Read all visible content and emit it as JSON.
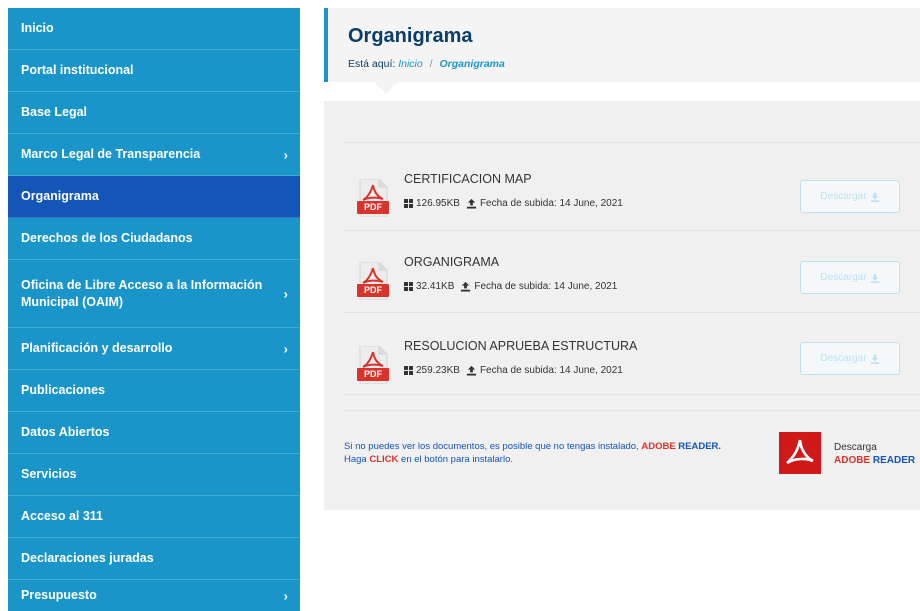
{
  "sidebar": {
    "items": [
      {
        "label": "Inicio",
        "has_submenu": false
      },
      {
        "label": "Portal institucional",
        "has_submenu": false
      },
      {
        "label": "Base Legal",
        "has_submenu": false
      },
      {
        "label": "Marco Legal de Transparencia",
        "has_submenu": true
      },
      {
        "label": "Organigrama",
        "has_submenu": false,
        "active": true
      },
      {
        "label": "Derechos de los Ciudadanos",
        "has_submenu": false
      },
      {
        "label": "Oficina de Libre Acceso a la Información Municipal (OAIM)",
        "has_submenu": true
      },
      {
        "label": "Planificación y desarrollo",
        "has_submenu": true
      },
      {
        "label": "Publicaciones",
        "has_submenu": false
      },
      {
        "label": "Datos Abiertos",
        "has_submenu": false
      },
      {
        "label": "Servicios",
        "has_submenu": false
      },
      {
        "label": "Acceso al 311",
        "has_submenu": false
      },
      {
        "label": "Declaraciones juradas",
        "has_submenu": false
      },
      {
        "label": "Presupuesto",
        "has_submenu": true
      }
    ],
    "chevron": "›"
  },
  "header": {
    "title": "Organigrama",
    "breadcrumb_prefix": "Está aquí:",
    "breadcrumb_home": "Inicio",
    "breadcrumb_sep": "/",
    "breadcrumb_current": "Organigrama"
  },
  "documents": [
    {
      "name": "CERTIFICACION MAP",
      "size": "126.95KB",
      "date_label": "Fecha de subida:",
      "date": "14 June, 2021",
      "badge": "PDF",
      "button": "Descargar"
    },
    {
      "name": "ORGANIGRAMA",
      "size": "32.41KB",
      "date_label": "Fecha de subida:",
      "date": "14 June, 2021",
      "badge": "PDF",
      "button": "Descargar"
    },
    {
      "name": "RESOLUCION APRUEBA ESTRUCTURA",
      "size": "259.23KB",
      "date_label": "Fecha de subida:",
      "date": "14 June, 2021",
      "badge": "PDF",
      "button": "Descargar"
    }
  ],
  "notice": {
    "line1": "Si no puedes ver los documentos, es posible que no tengas instalado,",
    "adobe": "ADOBE",
    "reader": "READER.",
    "line2_a": "Haga",
    "click": "CLICK",
    "line2_b": "en el botón para instalarlo."
  },
  "adobe_link": {
    "line1": "Descarga",
    "adobe": "ADOBE",
    "reader": "READER"
  },
  "colors": {
    "sidebar": "#1a95c9",
    "sidebar_active": "#1455b8",
    "title": "#0b3d66",
    "pdf_red": "#d9342b"
  },
  "icons": {
    "pdf": "pdf-file-icon",
    "size": "grid-icon",
    "upload": "upload-icon",
    "download": "download-icon",
    "adobe": "adobe-acrobat-icon"
  }
}
